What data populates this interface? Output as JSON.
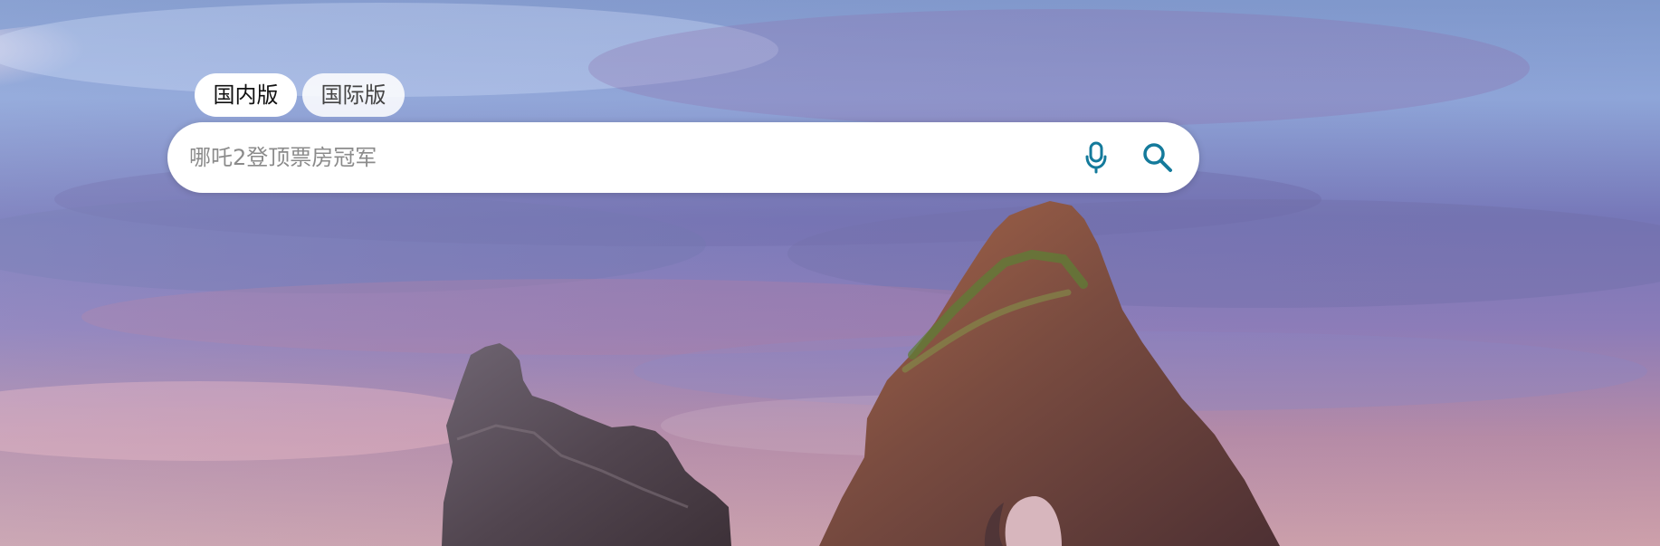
{
  "tabs": [
    {
      "label": "国内版",
      "active": true
    },
    {
      "label": "国际版",
      "active": false
    }
  ],
  "search": {
    "placeholder": "哪吒2登顶票房冠军",
    "value": ""
  },
  "icons": {
    "mic": "microphone-icon",
    "search": "search-icon"
  },
  "colors": {
    "accent": "#147a9b",
    "search_bg": "#ffffff",
    "tab_active_bg": "#ffffff",
    "tab_inactive_bg": "#f5f5f5"
  }
}
